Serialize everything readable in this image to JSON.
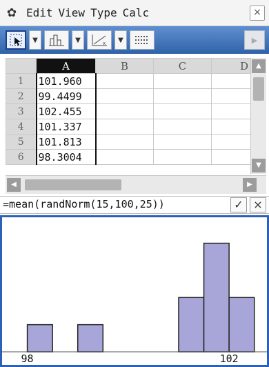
{
  "menubar": {
    "icon": "gear-icon",
    "items": [
      "Edit",
      "View",
      "Type",
      "Calc"
    ],
    "close_label": "×"
  },
  "toolbar": {
    "tools": [
      "select-arrow-icon",
      "histogram-icon",
      "scatter-axes-icon",
      "grid-cells-icon"
    ]
  },
  "spreadsheet": {
    "columns": [
      "A",
      "B",
      "C",
      "D"
    ],
    "active_column": "A",
    "rows": [
      {
        "num": "1",
        "A": "101.960"
      },
      {
        "num": "2",
        "A": "99.4499"
      },
      {
        "num": "3",
        "A": "102.455"
      },
      {
        "num": "4",
        "A": "101.337"
      },
      {
        "num": "5",
        "A": "101.813"
      },
      {
        "num": "6",
        "A": "98.3004"
      }
    ]
  },
  "formula": {
    "text": "=mean(randNorm(15,100,25))",
    "ok_label": "✓",
    "cancel_label": "×"
  },
  "chart_data": {
    "type": "bar",
    "bin_width": 0.5,
    "bins": [
      {
        "start": 98.0,
        "end": 98.5,
        "count": 1
      },
      {
        "start": 98.5,
        "end": 99.0,
        "count": 0
      },
      {
        "start": 99.0,
        "end": 99.5,
        "count": 1
      },
      {
        "start": 99.5,
        "end": 100.0,
        "count": 0
      },
      {
        "start": 100.0,
        "end": 100.5,
        "count": 0
      },
      {
        "start": 100.5,
        "end": 101.0,
        "count": 0
      },
      {
        "start": 101.0,
        "end": 101.5,
        "count": 2
      },
      {
        "start": 101.5,
        "end": 102.0,
        "count": 4
      },
      {
        "start": 102.0,
        "end": 102.5,
        "count": 2
      }
    ],
    "x_tick_labels": [
      {
        "value": 98,
        "label": "98"
      },
      {
        "value": 102,
        "label": "102"
      }
    ],
    "xlim": [
      97.5,
      102.75
    ],
    "ylim": [
      0,
      4.7
    ],
    "bar_fill": "#a8a6d8",
    "bar_stroke": "#222222"
  }
}
